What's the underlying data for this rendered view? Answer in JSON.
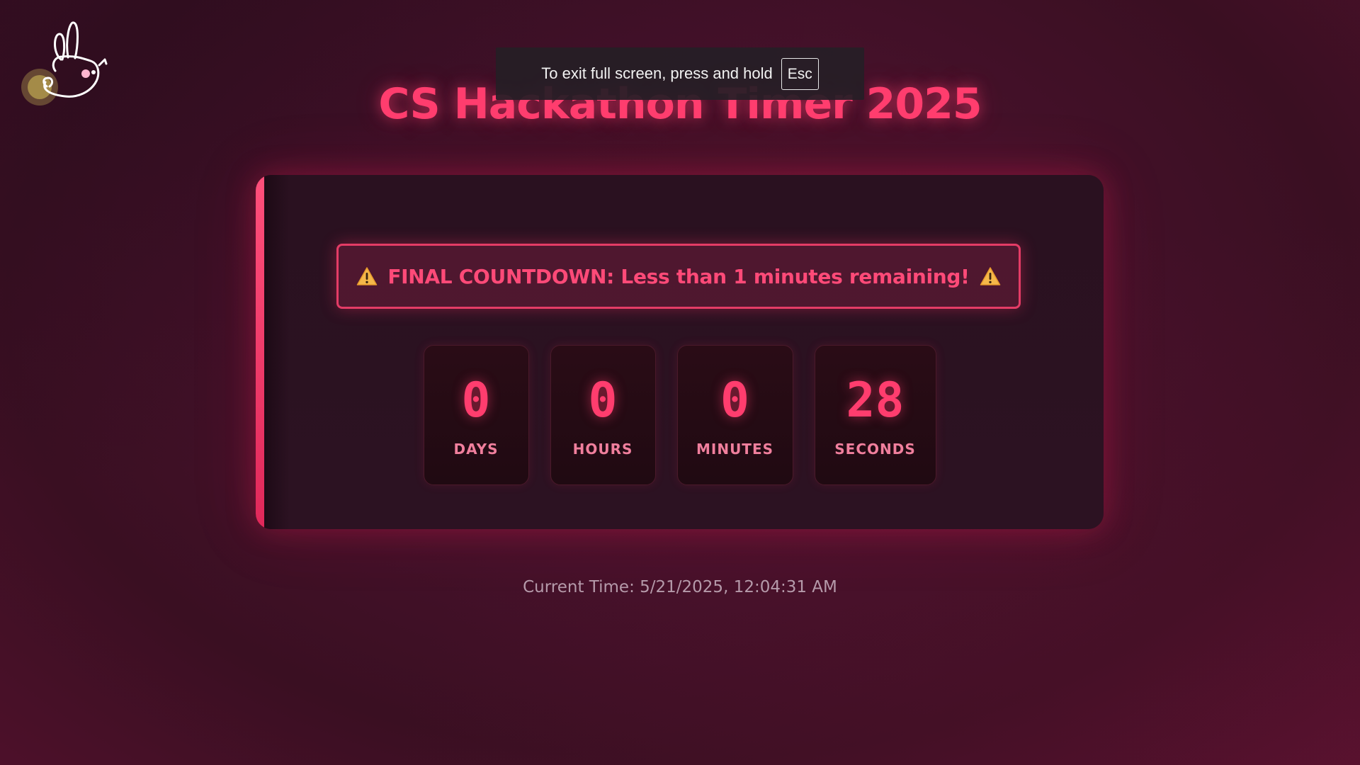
{
  "fullscreen_notice": {
    "text": "To exit full screen, press and hold",
    "key": "Esc"
  },
  "logo": {
    "icon": "bunny-logo-icon"
  },
  "header": {
    "title": "CS Hackathon Timer 2025"
  },
  "warning": {
    "icon": "warning-icon",
    "text": "FINAL COUNTDOWN: Less than 1 minutes remaining!"
  },
  "countdown": {
    "units": [
      {
        "value": "0",
        "label": "DAYS"
      },
      {
        "value": "0",
        "label": "HOURS"
      },
      {
        "value": "0",
        "label": "MINUTES"
      },
      {
        "value": "28",
        "label": "SECONDS"
      }
    ]
  },
  "footer": {
    "current_time": "Current Time: 5/21/2025, 12:04:31 AM"
  },
  "colors": {
    "accent": "#ff3d6e",
    "background": "#45112a",
    "card": "#2a1120",
    "warning_icon": "#f5b84a"
  }
}
